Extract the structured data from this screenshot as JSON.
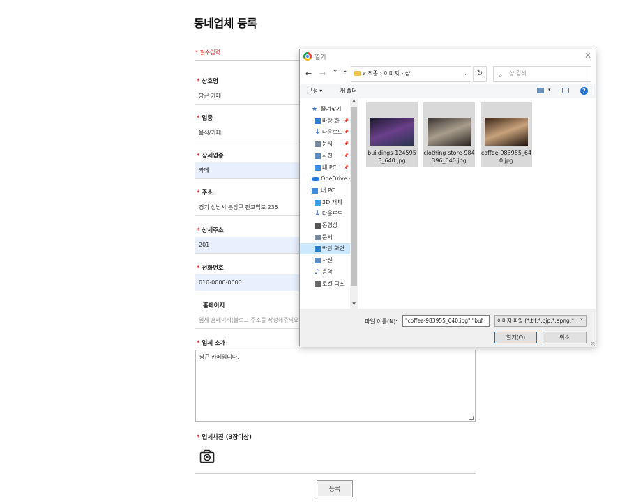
{
  "page": {
    "title": "동네업체 등록",
    "required_note": "* 필수입력",
    "fields": [
      {
        "label": "상호명",
        "required": true,
        "value": "당근 카페",
        "filled": false
      },
      {
        "label": "업종",
        "required": true,
        "value": "음식/카페",
        "filled": false
      },
      {
        "label": "상세업종",
        "required": true,
        "value": "카페",
        "filled": true
      },
      {
        "label": "주소",
        "required": true,
        "value": "경기 성남시 분당구 판교역로 235",
        "filled": false
      },
      {
        "label": "상세주소",
        "required": true,
        "value": "201",
        "filled": true
      },
      {
        "label": "전화번호",
        "required": true,
        "value": "010-0000-0000",
        "filled": true
      },
      {
        "label": "홈페이지",
        "required": false,
        "value": "업체 홈페이지(블로그 주소를 작성해주세요",
        "filled": false,
        "placeholder": true
      }
    ],
    "intro_label": "업체 소개",
    "intro_value": "당근 카페입니다.",
    "photo_label": "업체사진 (3장이상)",
    "submit_label": "등록"
  },
  "dialog": {
    "title": "열기",
    "close": "✕",
    "nav": {
      "back": "←",
      "forward": "→",
      "recent": "⌄",
      "up": "↑"
    },
    "breadcrumb": "« 최종 › 이미지 › 샵",
    "refresh": "↻",
    "search_placeholder": "샵 검색",
    "toolbar": {
      "organize": "구성 ▾",
      "new_folder": "새 폴더",
      "view_dropdown": "▾",
      "help": "?"
    },
    "nav_items": [
      {
        "label": "즐겨찾기",
        "level": 0,
        "icon": "star-icon",
        "color": "#2b6fcf",
        "pinned": false,
        "selected": false
      },
      {
        "label": "바탕 화",
        "level": 1,
        "icon": "desktop-icon",
        "color": "#2b7fd6",
        "pinned": true,
        "selected": false
      },
      {
        "label": "다운로드",
        "level": 1,
        "icon": "download-icon",
        "color": "#2b6fcf",
        "pinned": true,
        "selected": false
      },
      {
        "label": "문서",
        "level": 1,
        "icon": "document-icon",
        "color": "#7a8aa0",
        "pinned": true,
        "selected": false
      },
      {
        "label": "사진",
        "level": 1,
        "icon": "pictures-icon",
        "color": "#5b8ac0",
        "pinned": true,
        "selected": false
      },
      {
        "label": "내 PC",
        "level": 1,
        "icon": "pc-icon",
        "color": "#3d8be0",
        "pinned": true,
        "selected": false
      },
      {
        "label": "OneDrive -",
        "level": 0,
        "icon": "cloud-icon",
        "color": "#1e78d7",
        "pinned": false,
        "selected": false
      },
      {
        "label": "내 PC",
        "level": 0,
        "icon": "pc-icon",
        "color": "#3d8be0",
        "pinned": false,
        "selected": false
      },
      {
        "label": "3D 개체",
        "level": 1,
        "icon": "cube-icon",
        "color": "#3fa0e0",
        "pinned": false,
        "selected": false
      },
      {
        "label": "다운로드",
        "level": 1,
        "icon": "download-icon",
        "color": "#2b6fcf",
        "pinned": false,
        "selected": false
      },
      {
        "label": "동영상",
        "level": 1,
        "icon": "video-icon",
        "color": "#555",
        "pinned": false,
        "selected": false
      },
      {
        "label": "문서",
        "level": 1,
        "icon": "document-icon",
        "color": "#7a8aa0",
        "pinned": false,
        "selected": false
      },
      {
        "label": "바탕 화면",
        "level": 1,
        "icon": "desktop-icon",
        "color": "#2b7fd6",
        "pinned": false,
        "selected": true
      },
      {
        "label": "사진",
        "level": 1,
        "icon": "pictures-icon",
        "color": "#5b8ac0",
        "pinned": false,
        "selected": false
      },
      {
        "label": "음악",
        "level": 1,
        "icon": "music-icon",
        "color": "#2b6fcf",
        "pinned": false,
        "selected": false
      },
      {
        "label": "로컬 디스",
        "level": 1,
        "icon": "disk-icon",
        "color": "#666",
        "pinned": false,
        "selected": false
      }
    ],
    "files": [
      {
        "name": "buildings-1245953_640.jpg",
        "thumb_colors": [
          "#1b1a2e",
          "#6a3f8a",
          "#2a3550"
        ]
      },
      {
        "name": "clothing-store-984396_640.jpg",
        "thumb_colors": [
          "#3a3431",
          "#a89c8c",
          "#2c2622"
        ]
      },
      {
        "name": "coffee-983955_640.jpg",
        "thumb_colors": [
          "#3a2518",
          "#c8a27c",
          "#1f140d"
        ]
      }
    ],
    "filename_label": "파일 이름(N):",
    "filename_value": "\"coffee-983955_640.jpg\" \"bui",
    "filter_value": "이미지 파일 (*.tif;*.pjp;*.apng;*.",
    "open_label": "열기(O)",
    "cancel_label": "취소"
  }
}
